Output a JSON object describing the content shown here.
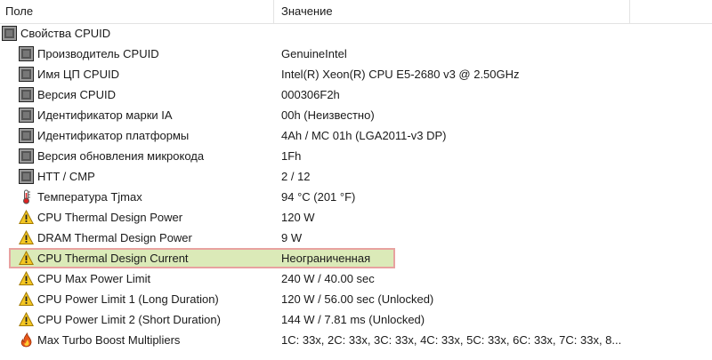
{
  "header": {
    "col_field": "Поле",
    "col_value": "Значение"
  },
  "section": {
    "label": "Свойства CPUID",
    "icon": "chip-icon"
  },
  "rows": [
    {
      "label": "Производитель CPUID",
      "value": "GenuineIntel",
      "icon": "chip-icon"
    },
    {
      "label": "Имя ЦП CPUID",
      "value": "Intel(R) Xeon(R) CPU E5-2680 v3 @ 2.50GHz",
      "icon": "chip-icon"
    },
    {
      "label": "Версия CPUID",
      "value": "000306F2h",
      "icon": "chip-icon"
    },
    {
      "label": "Идентификатор марки IA",
      "value": "00h  (Неизвестно)",
      "icon": "chip-icon"
    },
    {
      "label": "Идентификатор платформы",
      "value": "4Ah / MC 01h  (LGA2011-v3 DP)",
      "icon": "chip-icon"
    },
    {
      "label": "Версия обновления микрокода",
      "value": "1Fh",
      "icon": "chip-icon"
    },
    {
      "label": "HTT / CMP",
      "value": "2 / 12",
      "icon": "chip-icon"
    },
    {
      "label": "Температура Tjmax",
      "value": "94 °C  (201 °F)",
      "icon": "thermometer-icon"
    },
    {
      "label": "CPU Thermal Design Power",
      "value": "120 W",
      "icon": "warning-icon"
    },
    {
      "label": "DRAM Thermal Design Power",
      "value": "9 W",
      "icon": "warning-icon"
    },
    {
      "label": "CPU Thermal Design Current",
      "value": "Неограниченная",
      "icon": "warning-icon",
      "highlighted": true
    },
    {
      "label": "CPU Max Power Limit",
      "value": "240 W / 40.00 sec",
      "icon": "warning-icon"
    },
    {
      "label": "CPU Power Limit 1 (Long Duration)",
      "value": "120 W / 56.00 sec  (Unlocked)",
      "icon": "warning-icon"
    },
    {
      "label": "CPU Power Limit 2 (Short Duration)",
      "value": "144 W / 7.81 ms  (Unlocked)",
      "icon": "warning-icon"
    },
    {
      "label": "Max Turbo Boost Multipliers",
      "value": "1C: 33x, 2C: 33x, 3C: 33x, 4C: 33x, 5C: 33x, 6C: 33x, 7C: 33x, 8...",
      "icon": "flame-icon"
    }
  ],
  "colors": {
    "highlight_fill": "#dbeab8",
    "highlight_border": "#e8a2a0"
  }
}
